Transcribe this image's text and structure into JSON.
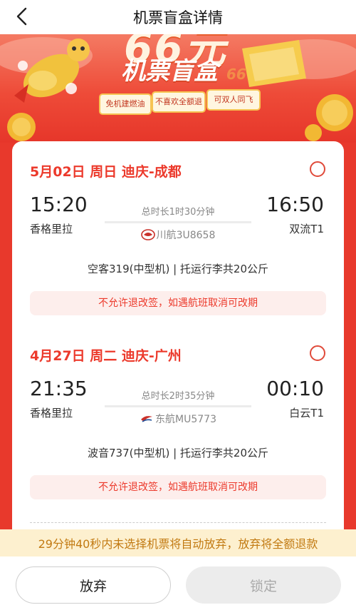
{
  "header": {
    "title": "机票盲盒详情"
  },
  "banner": {
    "headline_partial": "66元",
    "subtitle": "机票盲盒",
    "deco": "66",
    "tags": [
      "免机建燃油",
      "不喜欢全额退",
      "可双人同飞"
    ]
  },
  "flights": [
    {
      "date_route": "5月02日 周日 迪庆-成都",
      "dep_time": "15:20",
      "dep_airport": "香格里拉",
      "duration": "总时长1时30分钟",
      "airline": "川航3U8658",
      "arr_time": "16:50",
      "arr_airport": "双流T1",
      "plane_info": "空客319(中型机) | 托运行李共20公斤",
      "policy": "不允许退改签，如遇航班取消可改期"
    },
    {
      "date_route": "4月27日 周二 迪庆-广州",
      "dep_time": "21:35",
      "dep_airport": "香格里拉",
      "duration": "总时长2时35分钟",
      "airline": "东航MU5773",
      "arr_time": "00:10",
      "arr_airport": "白云T1",
      "plane_info": "波音737(中型机) | 托运行李共20公斤",
      "policy": "不允许退改签，如遇航班取消可改期"
    }
  ],
  "notice": "29分钟40秒内未选择机票将自动放弃，放弃将全额退款",
  "buttons": {
    "abandon": "放弃",
    "lock": "锁定"
  },
  "colors": {
    "accent": "#ec3a2c",
    "banner_red": "#e8392c",
    "notice_bg": "#fdf0cf",
    "notice_text": "#c27a12"
  },
  "icons": {
    "back": "chevron-left-icon",
    "sichuan": "sichuan-airlines-logo",
    "eastern": "china-eastern-logo"
  }
}
